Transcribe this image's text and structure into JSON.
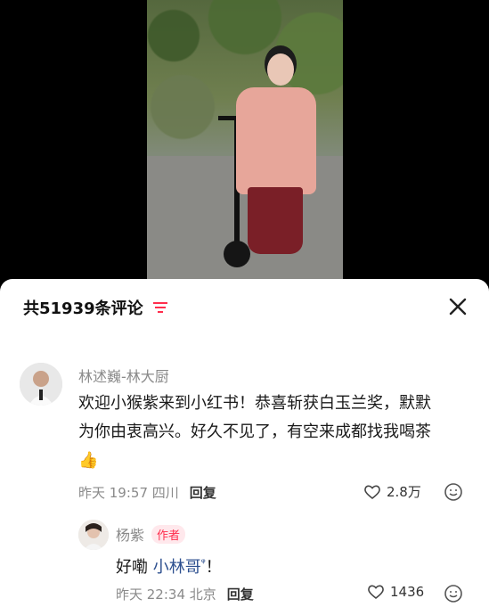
{
  "comments_header": {
    "count_label": "共51939条评论"
  },
  "comments": [
    {
      "user": "林述巍-林大厨",
      "text_line1": "欢迎小猴紫来到小红书！恭喜斩获白玉兰奖，默默",
      "text_line2": "为你由衷高兴。好久不见了，有空来成都找我喝茶",
      "emoji": "👍",
      "time": "昨天 19:57",
      "location": "四川",
      "reply_label": "回复",
      "likes": "2.8万"
    },
    {
      "user": "杨紫",
      "badge": "作者",
      "text_prefix": "好嘞 ",
      "mention": "小林哥",
      "search_mark": "ᵠ",
      "text_suffix": "！",
      "time": "昨天 22:34",
      "location": "北京",
      "reply_label": "回复",
      "likes": "1436"
    }
  ],
  "colors": {
    "accent": "#ff2e4d",
    "mention": "#2c4f8f"
  }
}
